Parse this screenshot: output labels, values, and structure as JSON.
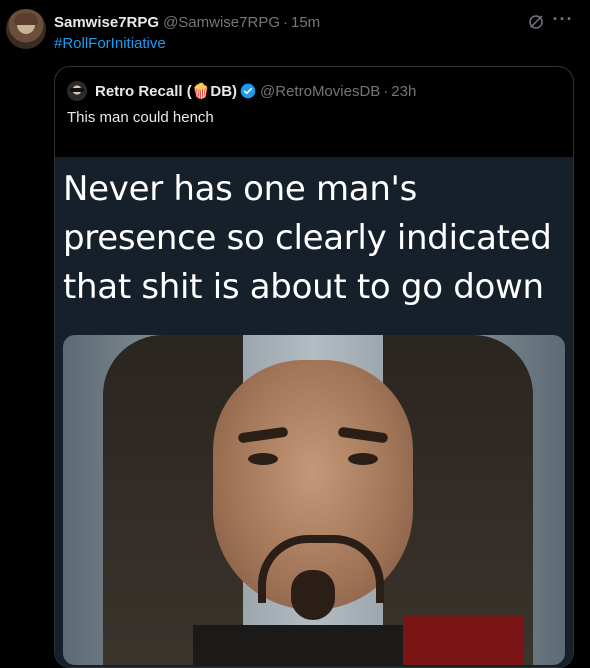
{
  "tweet": {
    "author_name": "Samwise7RPG",
    "author_handle": "@Samwise7RPG",
    "separator": "·",
    "time": "15m",
    "text": "#RollForInitiative",
    "icons": [
      "grok-icon",
      "more-icon"
    ],
    "more_label": "···"
  },
  "quote": {
    "author_name": "Retro Recall (🍿DB)",
    "author_handle": "@RetroMoviesDB",
    "separator": "·",
    "time": "23h",
    "text": "This man could hench",
    "verified": true,
    "meme_text": "Never has one man's presence so clearly indicated that shit is about to go down"
  },
  "colors": {
    "background": "#000000",
    "text": "#e7e9ea",
    "muted": "#71767b",
    "accent": "#1d9bf0",
    "meme_bg": "#15202b"
  }
}
